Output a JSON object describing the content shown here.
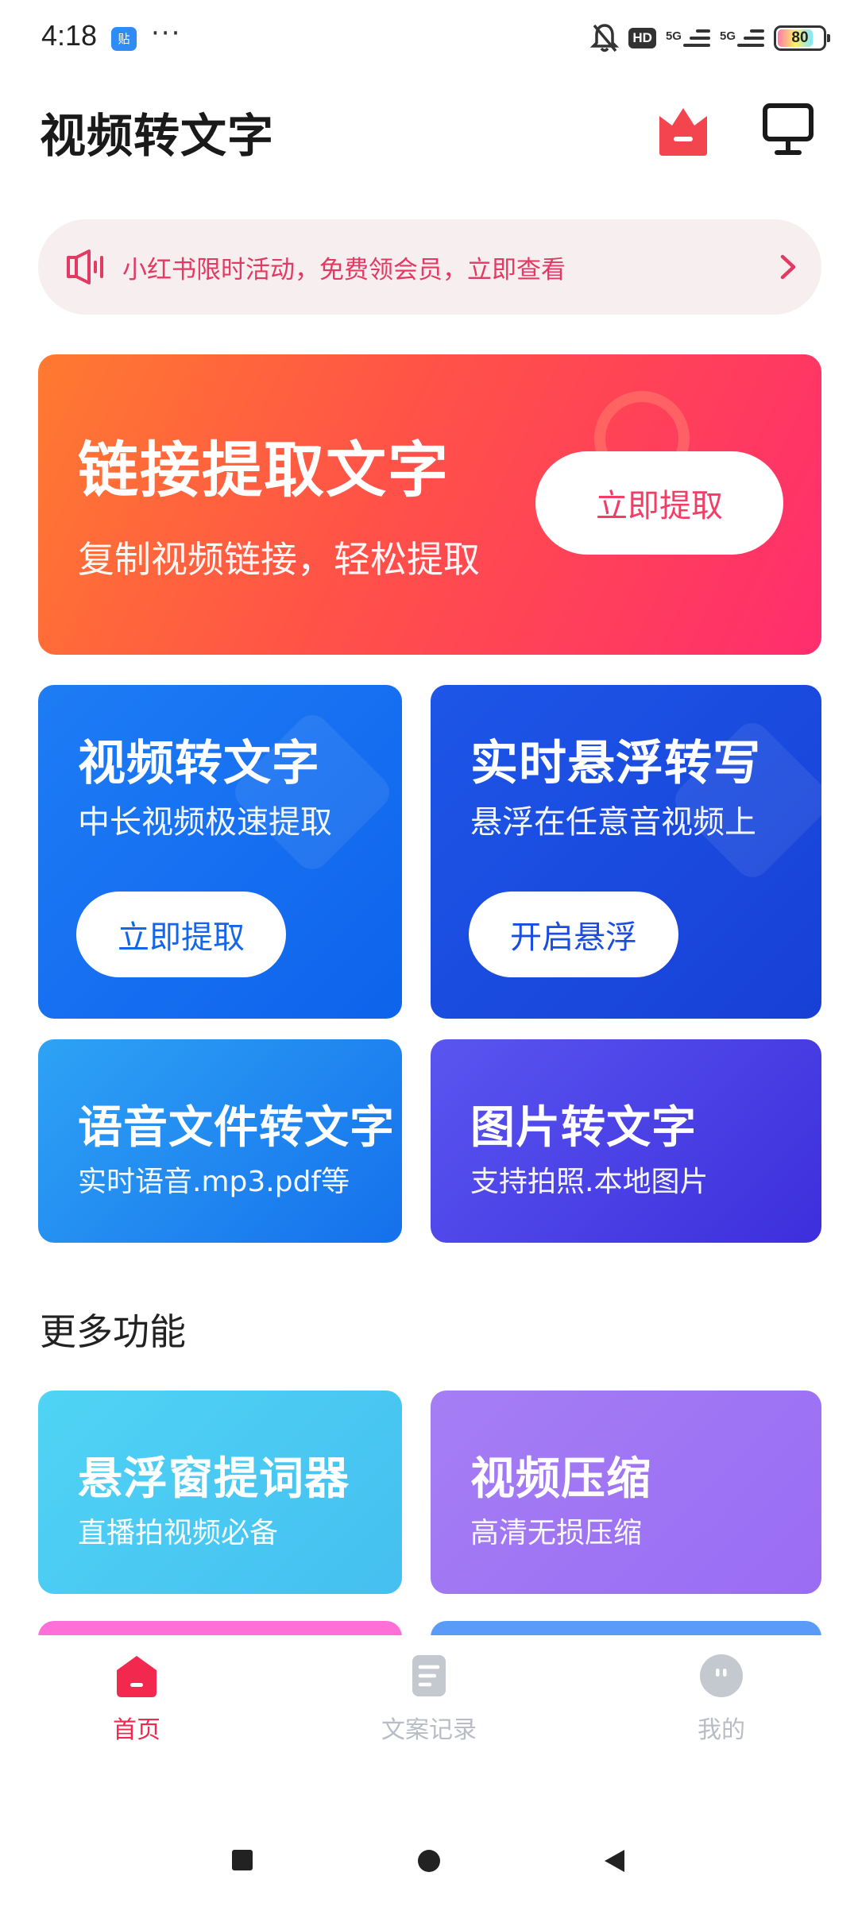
{
  "status_bar": {
    "time": "4:18",
    "app_badge": "贴",
    "more": "···",
    "hd": "HD",
    "sim1": "5G",
    "sim2": "5G",
    "battery": "80"
  },
  "header": {
    "title": "视频转文字",
    "crown_icon": "crown-icon",
    "monitor_icon": "monitor-icon"
  },
  "notice": {
    "text": "小红书限时活动，免费领会员，立即查看",
    "icon": "speaker-icon",
    "accent": "#e23a62"
  },
  "hero": {
    "title": "链接提取文字",
    "subtitle": "复制视频链接，轻松提取",
    "button": "立即提取"
  },
  "features": {
    "video_to_text": {
      "title": "视频转文字",
      "subtitle": "中长视频极速提取",
      "button": "立即提取"
    },
    "realtime_float": {
      "title": "实时悬浮转写",
      "subtitle": "悬浮在任意音视频上",
      "button": "开启悬浮"
    },
    "audio_file": {
      "title": "语音文件转文字",
      "subtitle": "实时语音.mp3.pdf等"
    },
    "image_to_text": {
      "title": "图片转文字",
      "subtitle": "支持拍照.本地图片"
    }
  },
  "more_section": {
    "title": "更多功能",
    "items": [
      {
        "title": "悬浮窗提词器",
        "subtitle": "直播拍视频必备"
      },
      {
        "title": "视频压缩",
        "subtitle": "高清无损压缩"
      }
    ]
  },
  "bottom_nav": {
    "items": [
      {
        "label": "首页",
        "icon": "home-icon",
        "active": true
      },
      {
        "label": "文案记录",
        "icon": "document-icon",
        "active": false
      },
      {
        "label": "我的",
        "icon": "profile-icon",
        "active": false
      }
    ],
    "active_color": "#f2284e",
    "inactive_color": "#b8bcc4"
  },
  "system_nav": {
    "recents_icon": "square-icon",
    "home_icon": "circle-icon",
    "back_icon": "triangle-back-icon"
  }
}
